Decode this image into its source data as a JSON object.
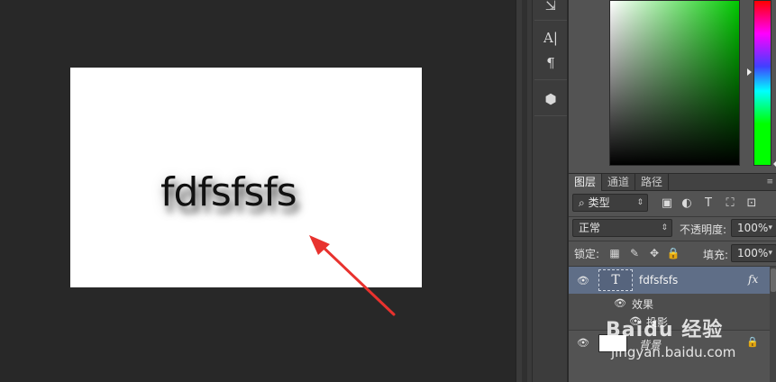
{
  "canvas": {
    "text": "fdfsfsfs",
    "background": "#ffffff"
  },
  "tools": [
    {
      "icon": "3d-rotate-icon",
      "glyph": "⇲"
    },
    {
      "icon": "character-icon",
      "glyph": "A|"
    },
    {
      "icon": "paragraph-icon",
      "glyph": "¶"
    },
    {
      "icon": "3d-cube-icon",
      "glyph": "⬢"
    }
  ],
  "panel_tabs": [
    "图层",
    "通道",
    "路径"
  ],
  "panel_menu_glyph": "≡",
  "filter": {
    "kind": "类型",
    "search_glyph": "⌕"
  },
  "filter_icons": [
    {
      "name": "pixel-filter-icon",
      "glyph": "▣"
    },
    {
      "name": "adjustment-filter-icon",
      "glyph": "◐"
    },
    {
      "name": "type-filter-icon",
      "glyph": "T"
    },
    {
      "name": "shape-filter-icon",
      "glyph": "⛶"
    },
    {
      "name": "smart-object-filter-icon",
      "glyph": "⊡"
    }
  ],
  "blend": {
    "mode": "正常",
    "opacity_label": "不透明度:",
    "opacity_value": "100%",
    "lock_label": "锁定:",
    "fill_label": "填充:",
    "fill_value": "100%"
  },
  "lock_icons": [
    {
      "name": "lock-transparency-icon",
      "glyph": "▦"
    },
    {
      "name": "lock-pixels-icon",
      "glyph": "✎"
    },
    {
      "name": "lock-position-icon",
      "glyph": "✥"
    },
    {
      "name": "lock-all-icon",
      "glyph": "🔒"
    }
  ],
  "layers": {
    "text_layer": {
      "name": "fdfsfsfs",
      "thumb": "T",
      "fx": "fx"
    },
    "effects_label": "效果",
    "shadow_label": "投影",
    "background": {
      "name": "背景",
      "lock": "🔒"
    }
  },
  "watermark": {
    "logo": "Baidu 经验",
    "url": "jingyan.baidu.com"
  },
  "colors": {
    "accent_selected_layer": "#5f6e87",
    "arrow": "#e8322e"
  }
}
